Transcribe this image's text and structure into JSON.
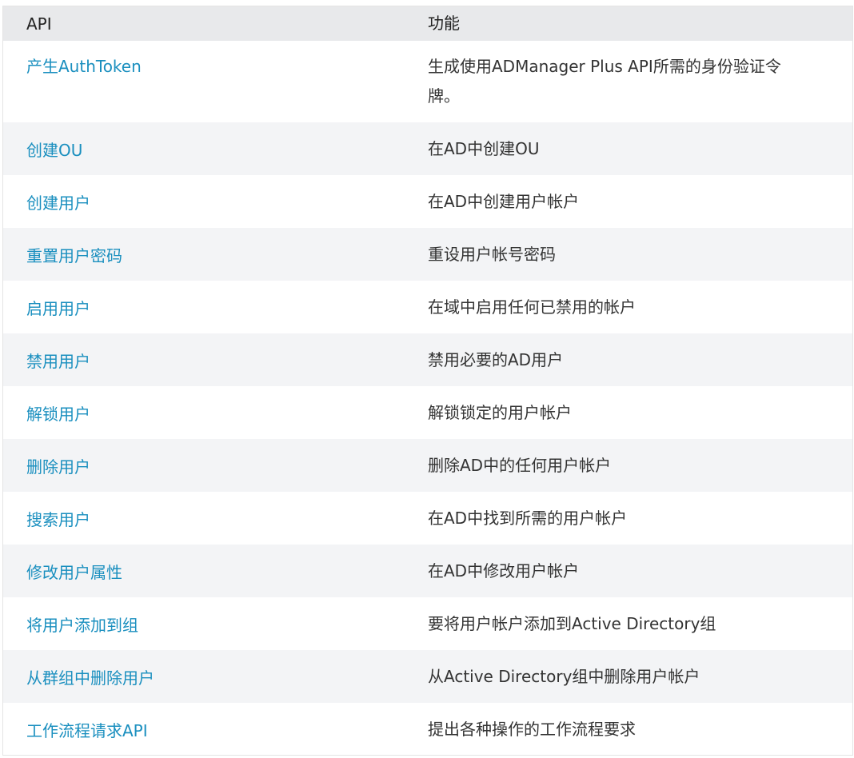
{
  "table": {
    "headers": {
      "api": "API",
      "function": "功能"
    },
    "rows": [
      {
        "api": "产生AuthToken",
        "function": "生成使用ADManager Plus API所需的身份验证令牌。"
      },
      {
        "api": "创建OU",
        "function": "在AD中创建OU"
      },
      {
        "api": "创建用户",
        "function": "在AD中创建用户帐户"
      },
      {
        "api": "重置用户密码",
        "function": "重设用户帐号密码"
      },
      {
        "api": "启用用户",
        "function": "在域中启用任何已禁用的帐户"
      },
      {
        "api": "禁用用户",
        "function": "禁用必要的AD用户"
      },
      {
        "api": "解锁用户",
        "function": "解锁锁定的用户帐户"
      },
      {
        "api": "删除用户",
        "function": "删除AD中的任何用户帐户"
      },
      {
        "api": "搜索用户",
        "function": "在AD中找到所需的用户帐户"
      },
      {
        "api": "修改用户属性",
        "function": "在AD中修改用户帐户"
      },
      {
        "api": "将用户添加到组",
        "function": "要将用户帐户添加到Active Directory组"
      },
      {
        "api": "从群组中删除用户",
        "function": "从Active Directory组中删除用户帐户"
      },
      {
        "api": "工作流程请求API",
        "function": "提出各种操作的工作流程要求"
      }
    ]
  },
  "colors": {
    "link": "#1a8fbf",
    "header_bg": "#e8e9eb",
    "alt_row_bg": "#f3f4f6",
    "text": "#333333"
  }
}
